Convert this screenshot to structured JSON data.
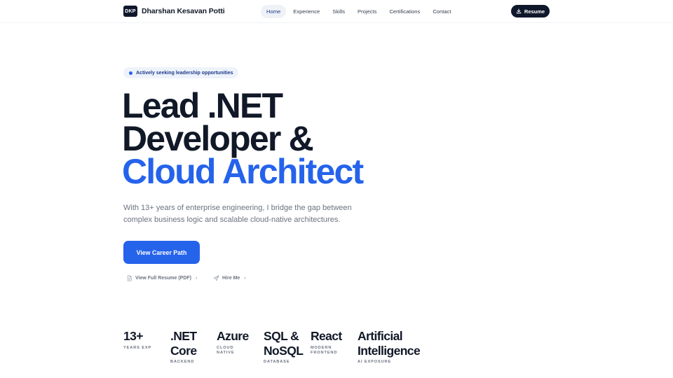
{
  "header": {
    "brand_mark": "DKP",
    "brand_name": "Dharshan Kesavan Potti",
    "nav": [
      {
        "label": "Home",
        "active": true
      },
      {
        "label": "Experience",
        "active": false
      },
      {
        "label": "Skills",
        "active": false
      },
      {
        "label": "Projects",
        "active": false
      },
      {
        "label": "Certifications",
        "active": false
      },
      {
        "label": "Contact",
        "active": false
      }
    ],
    "resume_label": "Resume",
    "resume_icon": "download-icon"
  },
  "hero": {
    "badge": "Actively seeking leadership opportunities",
    "title_lines": [
      "Lead .NET",
      "Developer &",
      "Cloud Architect"
    ],
    "description_lines": [
      "With 13+ years of enterprise engineering, I bridge the gap between",
      "complex business logic and scalable cloud-native architectures."
    ],
    "cta_label": "View Career Path",
    "links": {
      "resume": {
        "label": "View Full Resume (PDF)",
        "icon": "document-icon"
      },
      "hire": {
        "label": "Hire Me",
        "icon": "send-icon"
      },
      "chevron": "›"
    }
  },
  "stats": [
    {
      "value_lines": [
        "13+"
      ],
      "label_lines": [
        "YEARS EXP"
      ]
    },
    {
      "value_lines": [
        ".NET",
        "Core"
      ],
      "label_lines": [
        "BACKEND"
      ]
    },
    {
      "value_lines": [
        "Azure"
      ],
      "label_lines": [
        "CLOUD",
        "NATIVE"
      ]
    },
    {
      "value_lines": [
        "SQL &",
        "NoSQL"
      ],
      "label_lines": [
        "DATABASE"
      ]
    },
    {
      "value_lines": [
        "React"
      ],
      "label_lines": [
        "MODERN",
        "FRONTEND"
      ]
    },
    {
      "value_lines": [
        "Artificial",
        "Intelligence"
      ],
      "label_lines": [
        "AI EXPOSURE"
      ]
    }
  ],
  "colors": {
    "accent": "#2563eb",
    "dark": "#0f172a",
    "muted_text": "#6b7280"
  }
}
